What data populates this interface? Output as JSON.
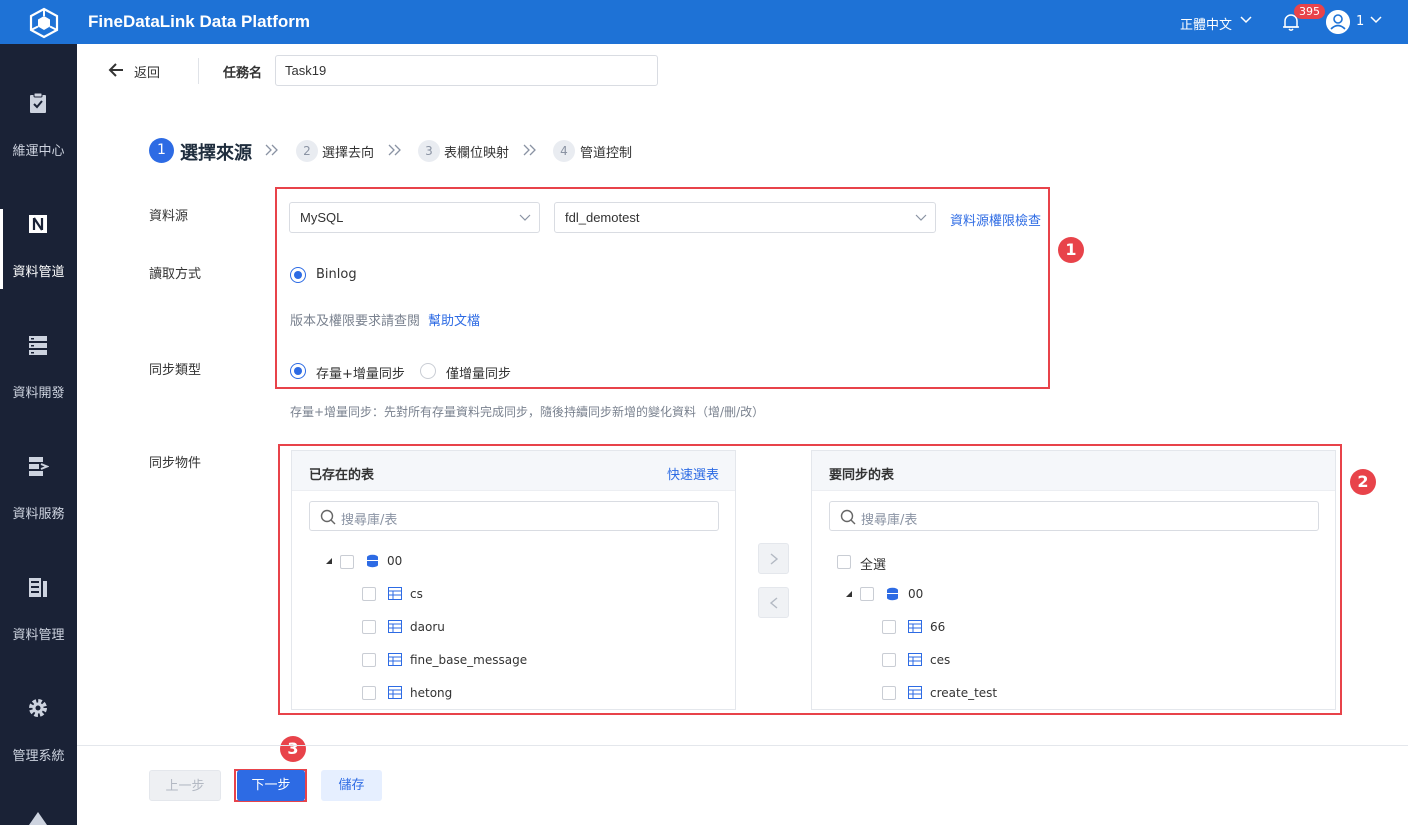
{
  "app": {
    "title": "FineDataLink Data Platform",
    "language": "正體中文",
    "notification_count": "395",
    "user": "1"
  },
  "sidebar": {
    "items": [
      {
        "label": "維運中心",
        "icon": "clipboard-check-icon"
      },
      {
        "label": "資料管道",
        "icon": "pipeline-icon"
      },
      {
        "label": "資料開發",
        "icon": "server-icon"
      },
      {
        "label": "資料服務",
        "icon": "data-service-icon"
      },
      {
        "label": "資料管理",
        "icon": "data-management-icon"
      },
      {
        "label": "管理系統",
        "icon": "gear-icon"
      }
    ]
  },
  "header": {
    "back_label": "返回",
    "task_name_label": "任務名",
    "task_name_value": "Task19"
  },
  "steps": [
    {
      "num": "1",
      "label": "選擇來源"
    },
    {
      "num": "2",
      "label": "選擇去向"
    },
    {
      "num": "3",
      "label": "表欄位映射"
    },
    {
      "num": "4",
      "label": "管道控制"
    }
  ],
  "form": {
    "source_label": "資料源",
    "source_type": "MySQL",
    "source_conn": "fdl_demotest",
    "permission_check": "資料源權限檢查",
    "read_mode_label": "讀取方式",
    "read_mode": "Binlog",
    "version_note": "版本及權限要求請查閱",
    "help_doc": "幫助文檔",
    "sync_type_label": "同步類型",
    "sync_full_incr": "存量+增量同步",
    "sync_incr_only": "僅增量同步",
    "sync_desc": "存量+增量同步：先對所有存量資料完成同步，隨後持續同步新增的變化資料（增/刪/改）",
    "sync_objects_label": "同步物件"
  },
  "left_panel": {
    "title": "已存在的表",
    "quick_select": "快速選表",
    "search_placeholder": "搜尋庫/表",
    "db": "00",
    "tables": [
      "cs",
      "daoru",
      "fine_base_message",
      "hetong"
    ]
  },
  "right_panel": {
    "title": "要同步的表",
    "search_placeholder": "搜尋庫/表",
    "select_all": "全選",
    "db": "00",
    "tables": [
      "66",
      "ces",
      "create_test"
    ]
  },
  "annotations": [
    "1",
    "2",
    "3"
  ],
  "footer": {
    "prev": "上一步",
    "next": "下一步",
    "save": "儲存"
  },
  "colors": {
    "topbar": "#1e72d6",
    "sidebar": "#1a2236",
    "accent": "#2d6be4",
    "annotation": "#e8434a"
  }
}
